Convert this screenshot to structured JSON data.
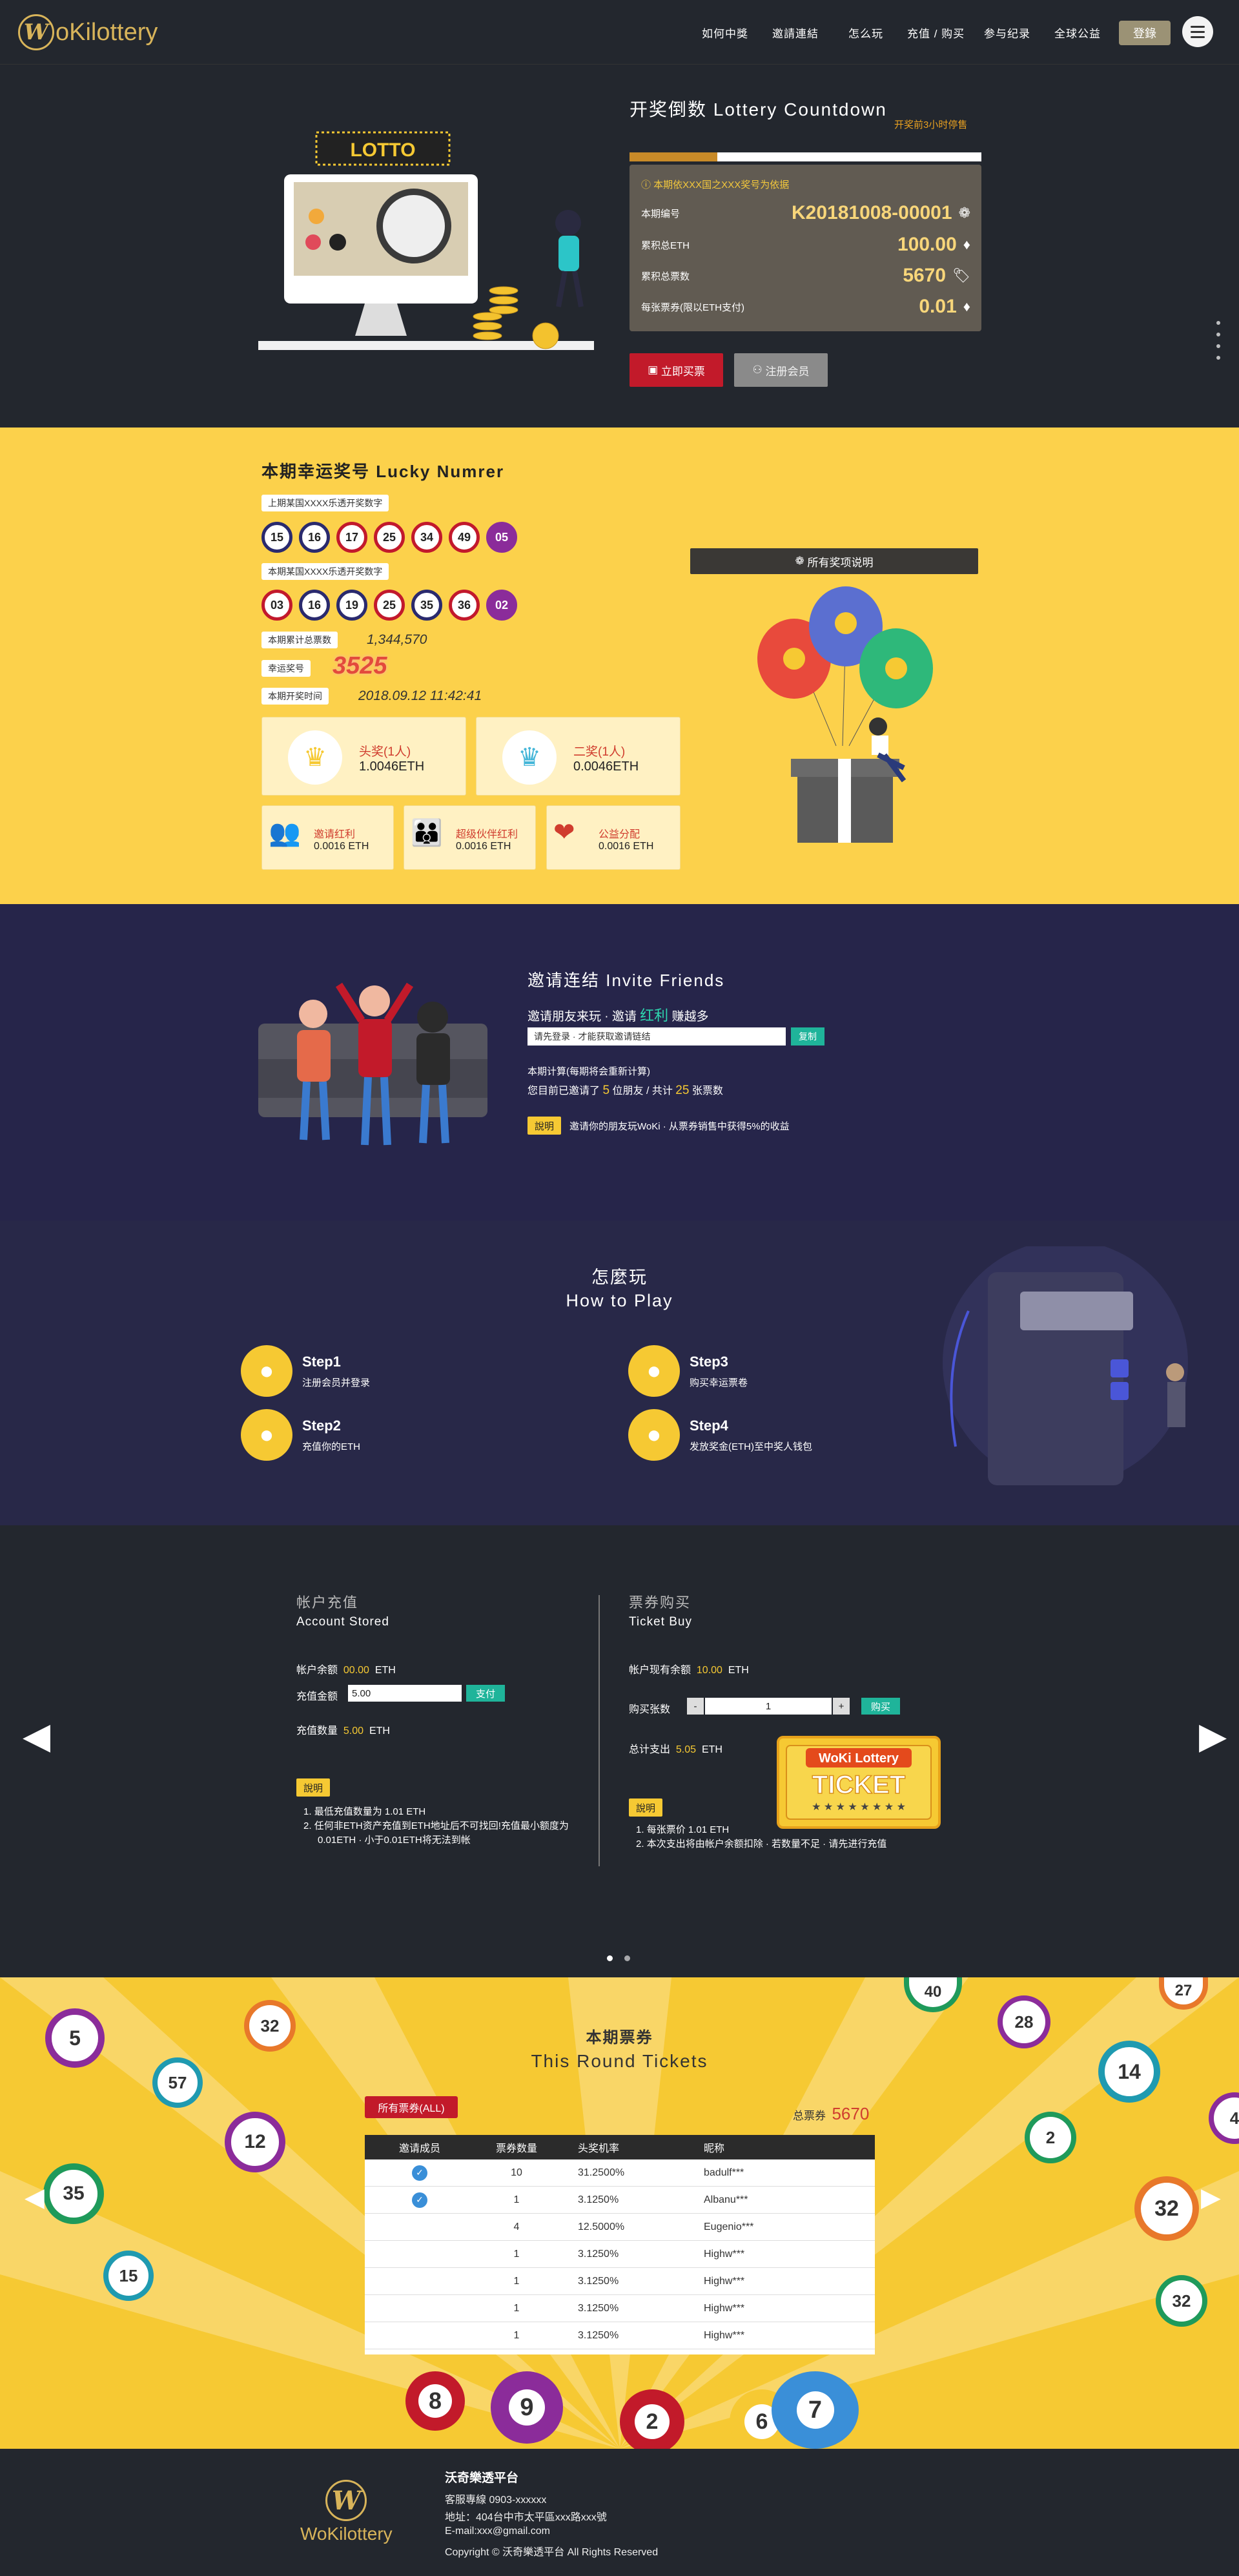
{
  "brand": {
    "logo_text": "oKilottery",
    "logo_initial": "W"
  },
  "nav": {
    "items": [
      "如何中獎",
      "邀請連結",
      "怎么玩",
      "充值 / 购买",
      "参与纪录",
      "全球公益"
    ],
    "login": "登錄"
  },
  "countdown": {
    "title": "开奖倒数 Lottery Countdown",
    "note": "开奖前3小时停售",
    "progress_fraction": 0.25,
    "basis": "本期依XXX国之XXX奖号为依据",
    "rows": [
      {
        "label": "本期编号",
        "value": "K20181008-00001",
        "icon": "gear-icon"
      },
      {
        "label": "累积总ETH",
        "value": "100.00",
        "icon": "eth-icon"
      },
      {
        "label": "累积总票数",
        "value": "5670",
        "icon": "ticket-icon"
      },
      {
        "label": "每张票券(限以ETH支付)",
        "value": "0.01",
        "icon": "eth-icon"
      }
    ],
    "buy_button": "立即买票",
    "register_button": "注册会员",
    "lotto_sign": "LOTTO"
  },
  "lucky": {
    "title": "本期幸运奖号 Lucky Numrer",
    "prev_label": "上期某国XXXX乐透开奖数字",
    "prev_balls": [
      "15",
      "16",
      "17",
      "25",
      "34",
      "49",
      "05"
    ],
    "curr_label": "本期某国XXXX乐透开奖数字",
    "curr_balls": [
      "03",
      "16",
      "19",
      "25",
      "35",
      "36",
      "02"
    ],
    "total_label": "本期累计总票数",
    "total_value": "1,344,570",
    "lucky_label": "幸运奖号",
    "lucky_value": "3525",
    "time_label": "本期开奖时间",
    "time_value": "2018.09.12 11:42:41",
    "first_prize": {
      "title": "头奖(1人)",
      "value": "1.0046ETH",
      "rank": "1"
    },
    "second_prize": {
      "title": "二奖(1人)",
      "value": "0.0046ETH",
      "rank": "2"
    },
    "small_prizes": [
      {
        "title": "邀请红利",
        "value": "0.0016 ETH"
      },
      {
        "title": "超级伙伴红利",
        "value": "0.0016 ETH"
      },
      {
        "title": "公益分配",
        "value": "0.0016 ETH"
      }
    ],
    "all_prizes_button": "所有奖项说明"
  },
  "invite": {
    "title": "邀请连结 Invite Friends",
    "sub_prefix": "邀请朋友来玩 · 邀请",
    "sub_highlight": "红利",
    "sub_suffix": "赚越多",
    "input_placeholder": "请先登录 · 才能获取邀请链结",
    "copy_button": "复制",
    "count_label": "本期计算(每期将会重新计算)",
    "count_prefix": "您目前已邀请了",
    "count_friends": "5",
    "count_mid": "位朋友 / 共计",
    "count_tickets": "25",
    "count_suffix": "张票数",
    "note_tag": "說明",
    "note_text": "邀请你的朋友玩WoKi · 从票券销售中获得5%的收益"
  },
  "how": {
    "title_cn": "怎麼玩",
    "title_en": "How to Play",
    "steps": [
      {
        "name": "Step1",
        "desc": "注册会员并登录"
      },
      {
        "name": "Step2",
        "desc": "充值你的ETH"
      },
      {
        "name": "Step3",
        "desc": "购买幸运票卷"
      },
      {
        "name": "Step4",
        "desc": "发放奖金(ETH)至中奖人钱包"
      }
    ]
  },
  "account": {
    "title_cn": "帐户充值",
    "title_en": "Account Stored",
    "balance_label": "帐户余额",
    "balance_value": "00.00",
    "unit": "ETH",
    "amount_label": "充值金额",
    "amount_value": "5.00",
    "pay_button": "支付",
    "qty_label": "充值数量",
    "qty_value": "5.00",
    "note_tag": "說明",
    "notes": [
      "最低充值数量为 1.01 ETH",
      "任何非ETH资产充值到ETH地址后不可找回!充值最小额度为0.01ETH · 小于0.01ETH将无法到帐"
    ]
  },
  "ticket_buy": {
    "title_cn": "票券购买",
    "title_en": "Ticket Buy",
    "balance_label": "帐户现有余额",
    "balance_value": "10.00",
    "unit": "ETH",
    "qty_label": "购买张数",
    "qty_value": "1",
    "minus": "-",
    "plus": "+",
    "buy_button": "购买",
    "total_label": "总计支出",
    "total_value": "5.05",
    "note_tag": "說明",
    "notes": [
      "每张票价 1.01 ETH",
      "本次支出将由帐户余额扣除 · 若数量不足 · 请先进行充值"
    ],
    "ticket_brand": "WoKi Lottery",
    "ticket_word": "TICKET"
  },
  "tickets": {
    "title_cn": "本期票券",
    "title_en": "This Round Tickets",
    "all_button": "所有票券(ALL)",
    "total_label": "总票券",
    "total_value": "5670",
    "headers": [
      "邀请成员",
      "票券数量",
      "头奖机率",
      "昵称"
    ],
    "rows": [
      {
        "invited": true,
        "count": "10",
        "rate": "31.2500%",
        "name": "badulf***"
      },
      {
        "invited": true,
        "count": "1",
        "rate": "3.1250%",
        "name": "Albanu***"
      },
      {
        "invited": false,
        "count": "4",
        "rate": "12.5000%",
        "name": "Eugenio***"
      },
      {
        "invited": false,
        "count": "1",
        "rate": "3.1250%",
        "name": "Highw***"
      },
      {
        "invited": false,
        "count": "1",
        "rate": "3.1250%",
        "name": "Highw***"
      },
      {
        "invited": false,
        "count": "1",
        "rate": "3.1250%",
        "name": "Highw***"
      },
      {
        "invited": false,
        "count": "1",
        "rate": "3.1250%",
        "name": "Highw***"
      }
    ],
    "deco_balls": [
      "5",
      "32",
      "57",
      "12",
      "35",
      "15",
      "28",
      "14",
      "2",
      "32",
      "4",
      "27",
      "40",
      "8",
      "9",
      "2",
      "6",
      "7"
    ]
  },
  "footer": {
    "logo_text": "WoKilottery",
    "title": "沃奇樂透平台",
    "phone": "客服專線 0903-xxxxxx",
    "address": "地址：404台中市太平區xxx路xxx號",
    "email": "E-mail:xxx@gmail.com",
    "copyright": "Copyright © 沃奇樂透平台 All Rights Reserved"
  },
  "colors": {
    "gold": "#d8b45a",
    "yellow": "#fcd14b",
    "dark": "#23272e",
    "navy": "#26254a",
    "red": "#c21a2a",
    "teal": "#1fb49a"
  }
}
